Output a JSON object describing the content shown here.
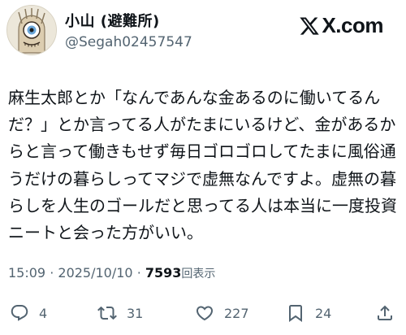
{
  "author": {
    "display_name": "小山 (避難所)",
    "handle": "@Segah02457547",
    "avatar_icon": "avatar-eye-face-icon"
  },
  "brand": {
    "label": "X.com",
    "icon": "x-logo-icon"
  },
  "tweet": {
    "text": "麻生太郎とか「なんであんな金あるのに働いてるんだ？」とか言ってる人がたまにいるけど、金があるからと言って働きもせず毎日ゴロゴロしてたまに風俗通うだけの暮らしってマジで虚無なんですよ。虚無の暮らしを人生のゴールだと思ってる人は本当に一度投資ニートと会った方がいい。"
  },
  "meta": {
    "time": "15:09",
    "separator": "·",
    "date": "2025/10/10",
    "views": "7593",
    "views_label": "回表示"
  },
  "actions": {
    "reply": {
      "icon": "reply-icon",
      "count": "4"
    },
    "repost": {
      "icon": "repost-icon",
      "count": "31"
    },
    "like": {
      "icon": "heart-icon",
      "count": "227"
    },
    "bookmark": {
      "icon": "bookmark-icon",
      "count": "24"
    },
    "share": {
      "icon": "share-icon"
    }
  },
  "colors": {
    "text_primary": "#0f1419",
    "text_secondary": "#536471",
    "background": "#ffffff"
  }
}
